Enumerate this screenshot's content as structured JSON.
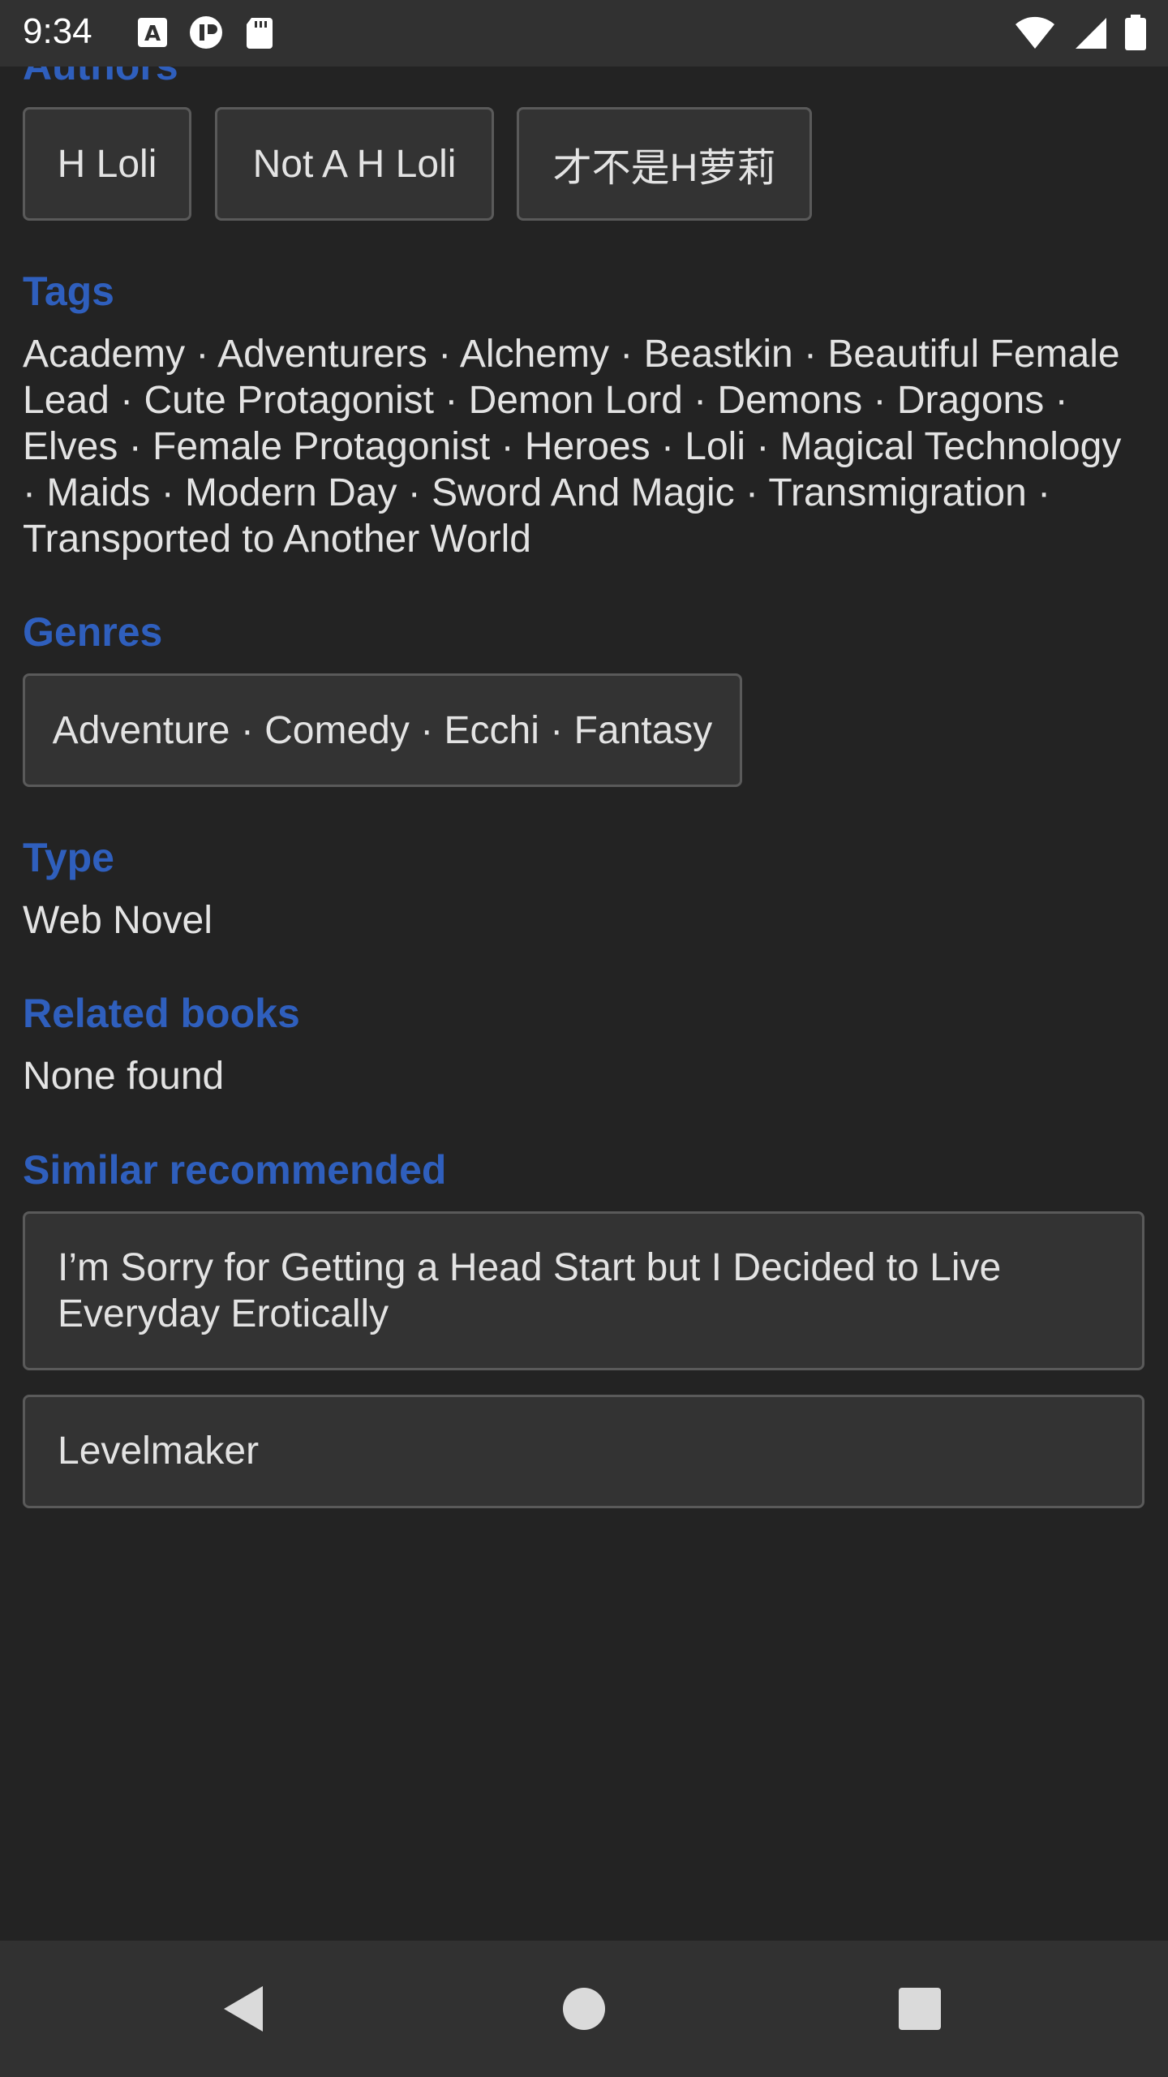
{
  "status_bar": {
    "time": "9:34",
    "left_icons": [
      "a-font-icon",
      "privacy-icon",
      "sd-card-icon"
    ],
    "right_icons": [
      "wifi-icon",
      "cell-signal-icon",
      "battery-icon"
    ]
  },
  "colors": {
    "background": "#232323",
    "accent": "#2f5fbd",
    "chip_bg": "#333333",
    "chip_border": "#5a5a5a",
    "text": "#e3e3e3"
  },
  "authors": {
    "title": "Authors",
    "items": [
      "H Loli",
      "Not A H Loli",
      "才不是H萝莉"
    ]
  },
  "tags": {
    "title": "Tags",
    "lines": [
      "Academy · Adventurers · Alchemy · Beastkin · Beautiful Female",
      "Lead · Cute Protagonist · Demon Lord · Demons · Dragons ·",
      "Elves · Female Protagonist · Heroes · Loli · Magical Technology",
      "· Maids · Modern Day · Sword And Magic · Transmigration ·",
      "Transported to Another World"
    ]
  },
  "genres": {
    "title": "Genres",
    "value": "Adventure · Comedy · Ecchi · Fantasy"
  },
  "type": {
    "title": "Type",
    "value": "Web Novel"
  },
  "related_books": {
    "title": "Related books",
    "value": "None found"
  },
  "similar_recommended": {
    "title": "Similar recommended",
    "items": [
      {
        "line1": "I’m Sorry for Getting a Head Start but I Decided to Live",
        "line2": "Everyday Erotically"
      },
      {
        "line1": "Levelmaker",
        "line2": ""
      }
    ]
  },
  "nav_bar": {
    "buttons": [
      "back-icon",
      "home-icon",
      "recents-icon"
    ]
  }
}
